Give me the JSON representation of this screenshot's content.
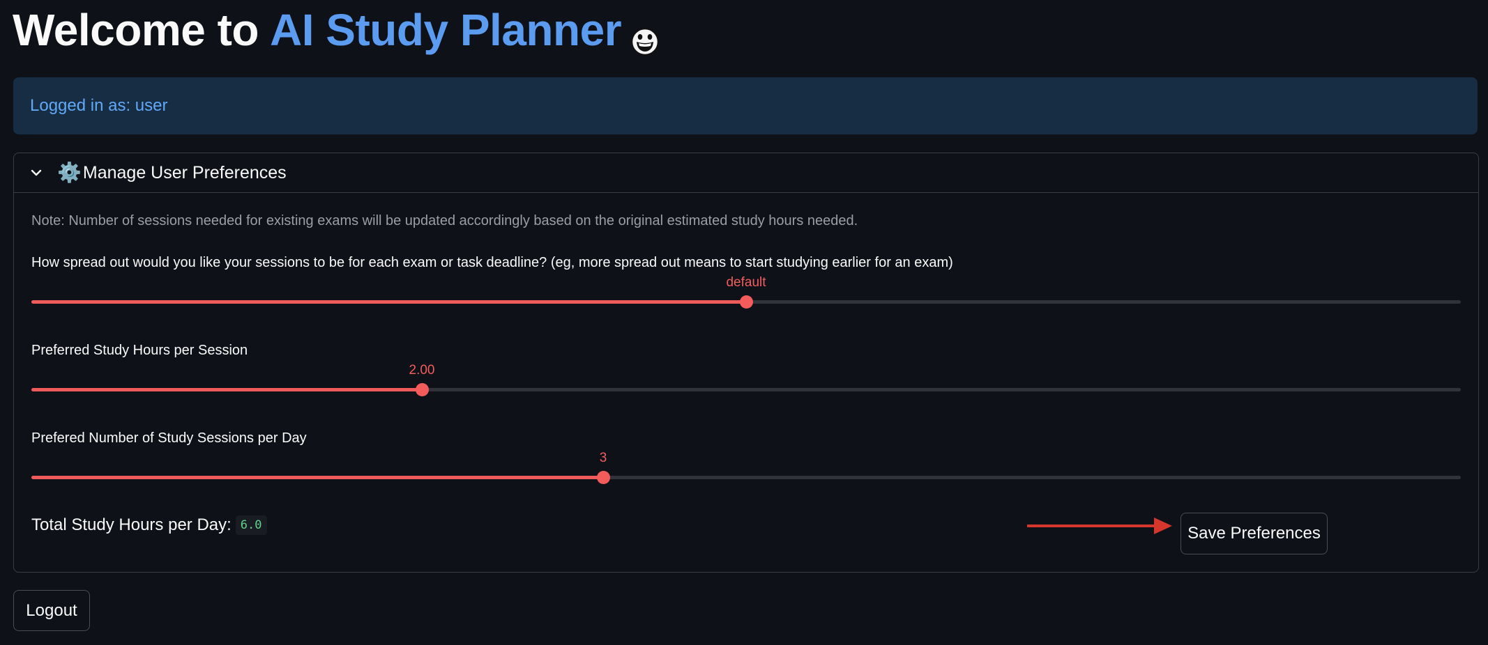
{
  "header": {
    "title_prefix": "Welcome to",
    "title_accent": "AI Study Planner",
    "emoji_icon": "grinning-face-icon"
  },
  "status": {
    "logged_in_text": "Logged in as: user"
  },
  "preferences": {
    "expander_label": "Manage User Preferences",
    "expander_icon": "gear-icon",
    "expanded": true,
    "note": "Note: Number of sessions needed for existing exams will be updated accordingly based on the original estimated study hours needed.",
    "sliders": [
      {
        "label": "How spread out would you like your sessions to be for each exam or task deadline? (eg, more spread out means to start studying earlier for an exam)",
        "value_label": "default",
        "fraction": 0.5
      },
      {
        "label": "Preferred Study Hours per Session",
        "value_label": "2.00",
        "fraction": 0.273
      },
      {
        "label": "Prefered Number of Study Sessions per Day",
        "value_label": "3",
        "fraction": 0.4
      }
    ],
    "total_label": "Total Study Hours per Day:",
    "total_value": "6.0",
    "save_button": "Save Preferences"
  },
  "footer": {
    "logout_button": "Logout"
  },
  "colors": {
    "background": "#0e1117",
    "accent_blue": "#5b9bf0",
    "slider_red": "#f45c5c",
    "info_bg": "#172d43",
    "annotation_arrow": "#d6362b"
  }
}
